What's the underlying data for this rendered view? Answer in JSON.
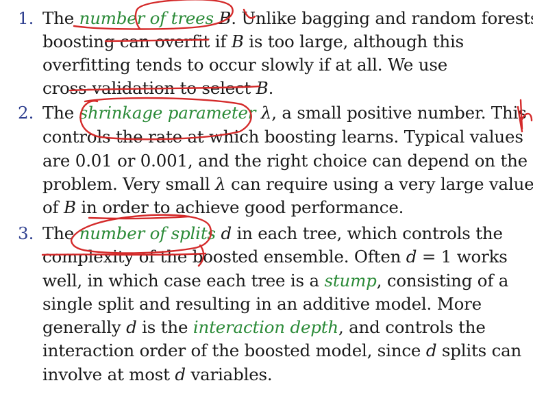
{
  "items": [
    {
      "number": "1.",
      "lines": [
        [
          "The ",
          "number of trees",
          " ",
          "B",
          ". Unlike bagging and random forests,"
        ],
        [
          "boosting can overfit if ",
          "B",
          " is too large, although this"
        ],
        [
          "overfitting tends to occur slowly if at all. We use"
        ],
        [
          "cross-validation to select ",
          "B",
          "."
        ]
      ]
    },
    {
      "number": "2.",
      "lines": [
        [
          "The ",
          "shrinkage parameter",
          " ",
          "λ",
          ", a small positive number. This"
        ],
        [
          "controls the rate at which boosting learns. Typical values"
        ],
        [
          "are 0.01 or 0.001, and the right choice can depend on the"
        ],
        [
          "problem. Very small ",
          "λ",
          " can require using a very large value"
        ],
        [
          "of ",
          "B",
          " in order to achieve good performance."
        ]
      ]
    },
    {
      "number": "3.",
      "lines": [
        [
          "The ",
          "number of splits",
          " ",
          "d",
          " in each tree, which controls the"
        ],
        [
          "complexity of the boosted ensemble. Often ",
          "d",
          " = 1 works"
        ],
        [
          "well, in which case each tree is a ",
          "stump",
          ", consisting of a"
        ],
        [
          "single split and resulting in an additive model. More"
        ],
        [
          "generally ",
          "d",
          " is the ",
          "interaction depth",
          ", and controls the"
        ],
        [
          "interaction order of the boosted model, since ",
          "d",
          " splits can"
        ],
        [
          "involve at most ",
          "d",
          " variables."
        ]
      ]
    }
  ],
  "ink_color": "#d42a2a",
  "term_color": "#2a8a37",
  "number_color": "#2e3f8f"
}
